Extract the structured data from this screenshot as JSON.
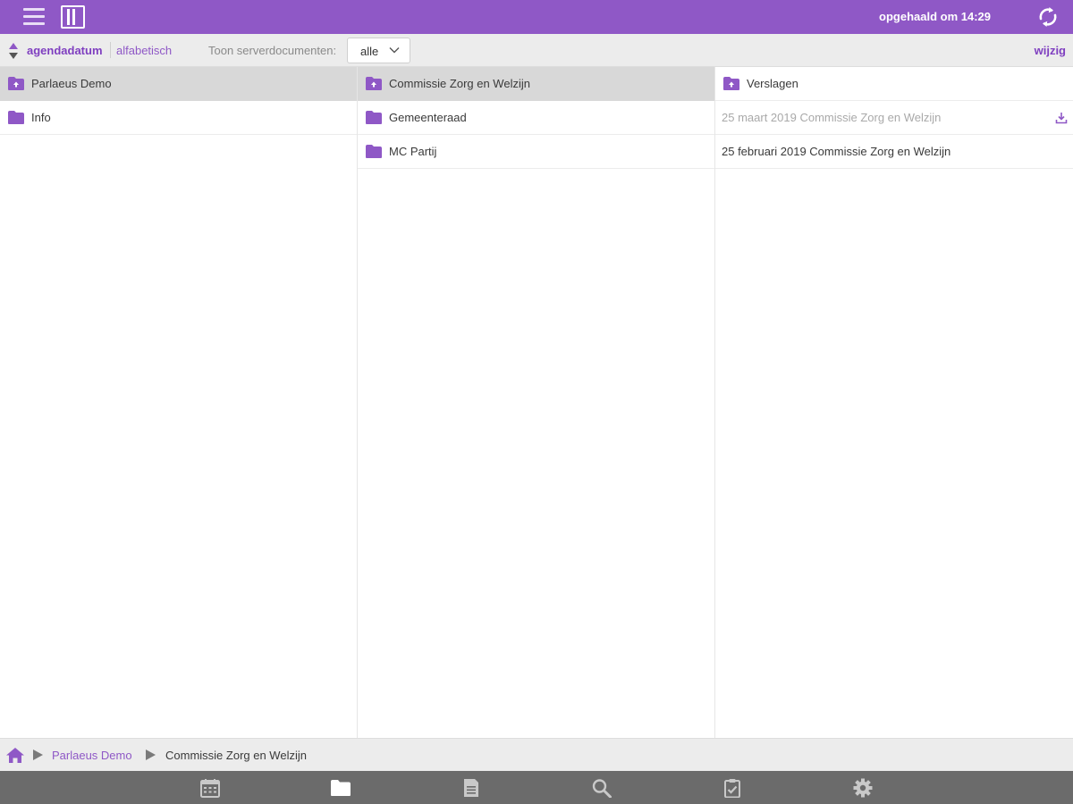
{
  "topbar": {
    "menu_icon": "hamburger-menu-icon",
    "columns_icon": "columns-view-icon",
    "fetched_text": "opgehaald om 14:29",
    "refresh_icon": "refresh-icon"
  },
  "toolbar": {
    "sort_option_active": "agendadatum",
    "sort_option_other": "alfabetisch",
    "show_server_docs_label": "Toon serverdocumenten:",
    "show_server_docs_value": "alle",
    "edit_label": "wijzig"
  },
  "columns": [
    {
      "header": "Parlaeus Demo",
      "items": [
        "Info"
      ]
    },
    {
      "header": "Commissie Zorg en Welzijn",
      "items": [
        "Gemeenteraad",
        "MC Partij"
      ]
    },
    {
      "header": "Verslagen",
      "items": [
        "25 maart 2019 Commissie Zorg en Welzijn",
        "25 februari 2019 Commissie Zorg en Welzijn"
      ]
    }
  ],
  "breadcrumb": {
    "items": [
      "Parlaeus Demo",
      "Commissie Zorg en Welzijn"
    ]
  },
  "bottom_nav": {
    "icons": [
      "calendar-icon",
      "folder-icon",
      "document-icon",
      "search-icon",
      "clipboard-check-icon",
      "gear-icon"
    ],
    "active": "folder-icon"
  },
  "colors": {
    "accent": "#8f58c6",
    "toolbar_bg": "#ececec",
    "nav_bg": "#6b6b6b",
    "active_header_bg": "#d8d8d8"
  }
}
